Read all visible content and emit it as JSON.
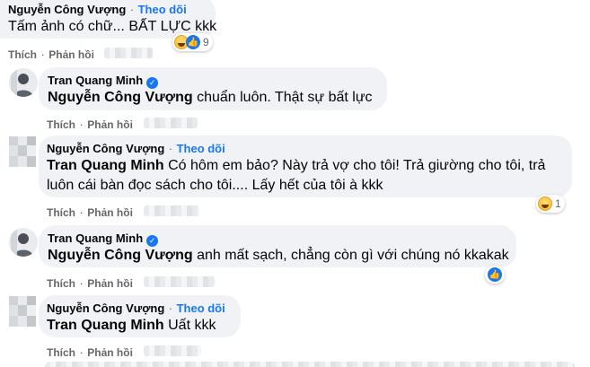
{
  "comments": [
    {
      "author": "Nguyễn Công Vượng",
      "follow": "Theo dõi",
      "text": "Tấm ảnh có chữ... BẤT LỰC kkk",
      "reaction_count": "9",
      "like": "Thích",
      "reply": "Phản hồi"
    },
    {
      "author": "Tran Quang Minh",
      "mention": "Nguyễn Công Vượng",
      "text": " chuẩn luôn. Thật sự bất lực",
      "like": "Thích",
      "reply": "Phản hồi"
    },
    {
      "author": "Nguyễn Công Vượng",
      "follow": "Theo dõi",
      "mention": "Tran Quang Minh",
      "text_line1": " Có hôm em bảo? Này trả vợ cho tôi! Trả giường cho tôi, trả",
      "text_line2": "luôn cái bàn đọc sách cho tôi.... Lấy hết của tôi à kkk",
      "reaction_count": "1",
      "like": "Thích",
      "reply": "Phản hồi"
    },
    {
      "author": "Tran Quang Minh",
      "mention": "Nguyễn Công Vượng",
      "text": " anh mất sạch, chẳng còn gì với chúng nó kkakak",
      "like": "Thích",
      "reply": "Phản hồi"
    },
    {
      "author": "Nguyễn Công Vượng",
      "follow": "Theo dõi",
      "mention": "Tran Quang Minh",
      "text": " Uất kkk",
      "like": "Thích",
      "reply": "Phản hồi"
    }
  ],
  "separator": "·",
  "icons": {
    "haha": "haha-reaction-icon",
    "like": "like-reaction-icon",
    "verified": "verified-badge-icon"
  },
  "colors": {
    "bubble": "#f0f2f5",
    "follow": "#1877f2",
    "meta": "#65676b"
  }
}
